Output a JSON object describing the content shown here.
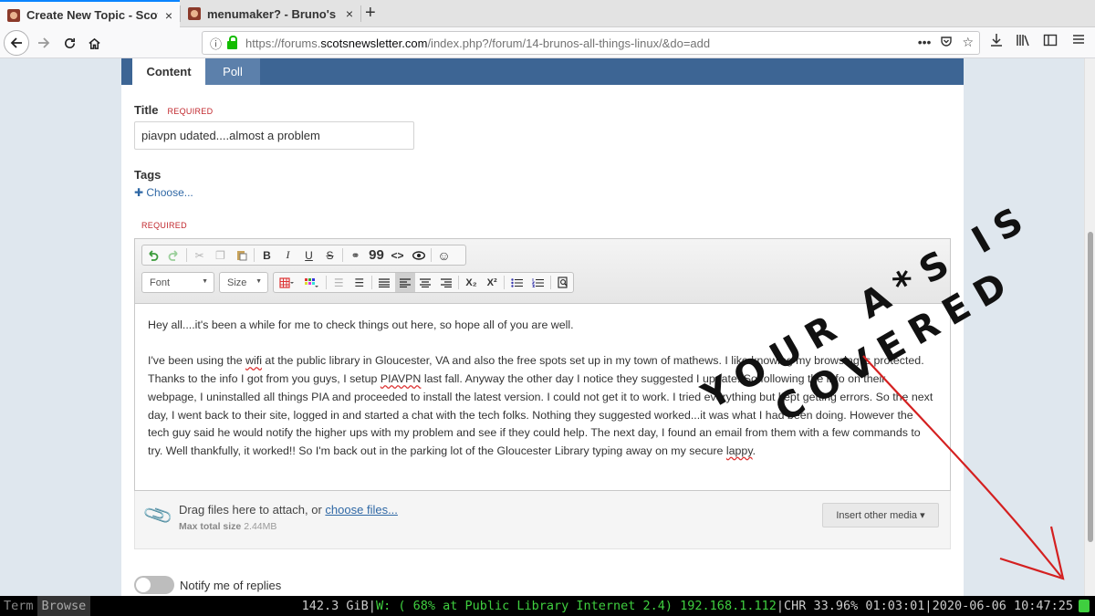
{
  "browser": {
    "tabs": [
      {
        "label": "Create New Topic - Scot's",
        "close": "×"
      },
      {
        "label": "menumaker? - Bruno's Al",
        "close": "×"
      }
    ],
    "new_tab": "+",
    "url_prefix": "https://forums.",
    "url_domain": "scotsnewsletter.com",
    "url_path": "/index.php?/forum/14-brunos-all-things-linux/&do=add"
  },
  "form": {
    "tabs": [
      "Content",
      "Poll"
    ],
    "title_label": "Title",
    "required": "REQUIRED",
    "title_value": "piavpn udated....almost a problem",
    "tags_label": "Tags",
    "choose": "Choose...",
    "toolbar": {
      "font": "Font",
      "size": "Size",
      "bold": "B",
      "italic": "I",
      "underline": "U",
      "strike": "S",
      "quote": "99",
      "code": "<>",
      "subscript": "X₂",
      "superscript": "X²"
    },
    "body": {
      "p1": "Hey all....it's been a while for me to check things out here, so hope all of you are well.",
      "p2_a": "I've been using the ",
      "p2_wifi": "wifi",
      "p2_b": " at the public library in Gloucester, VA and also the free spots set up in my town of mathews.  I like knowing my browsing is protected.  Thanks to the info I got from you guys, I setup ",
      "p2_piavpn": "PIAVPN",
      "p2_c": " last fall.  Anyway the other day I notice they suggested I update.  So following the info on their webpage,  I uninstalled all things PIA and proceeded to install the latest version.  I could not get it to work.  I tried everything but kept getting errors.  So the next day, I went back to their site, logged in and started a chat with the tech folks.  Nothing they suggested worked...it was what I had been doing.  However the tech guy said he would notify the higher ups with my problem and see if they could help.  The next day, I found an email from them with a few commands to try.  Well thankfully, it worked!!  So I'm back out in the parking lot of the Gloucester Library typing away on my secure ",
      "p2_lappy": "lappy",
      "p2_end": "."
    },
    "attach_text": "Drag files here to attach, or ",
    "attach_link": "choose files...",
    "max_label": "Max total size",
    "max_value": "2.44MB",
    "insert_media": "Insert other media ▾",
    "notify": "Notify me of replies"
  },
  "watermark": {
    "line1": "YOUR A*S IS",
    "line2": "COVERED"
  },
  "statusbar": {
    "workspaces": [
      "Term",
      "Browse"
    ],
    "disk": "142.3 GiB",
    "wifi": "W: ( 68% at Public Library Internet 2.4) 192.168.1.112",
    "battery": "CHR 33.96% 01:03:01",
    "datetime": "2020-06-06 10:47:25"
  },
  "colors": {
    "accent": "#3d6594",
    "link": "#2f68a5",
    "required": "#c1272d",
    "arrow": "#d42020",
    "status_green": "#3fcf3f"
  }
}
